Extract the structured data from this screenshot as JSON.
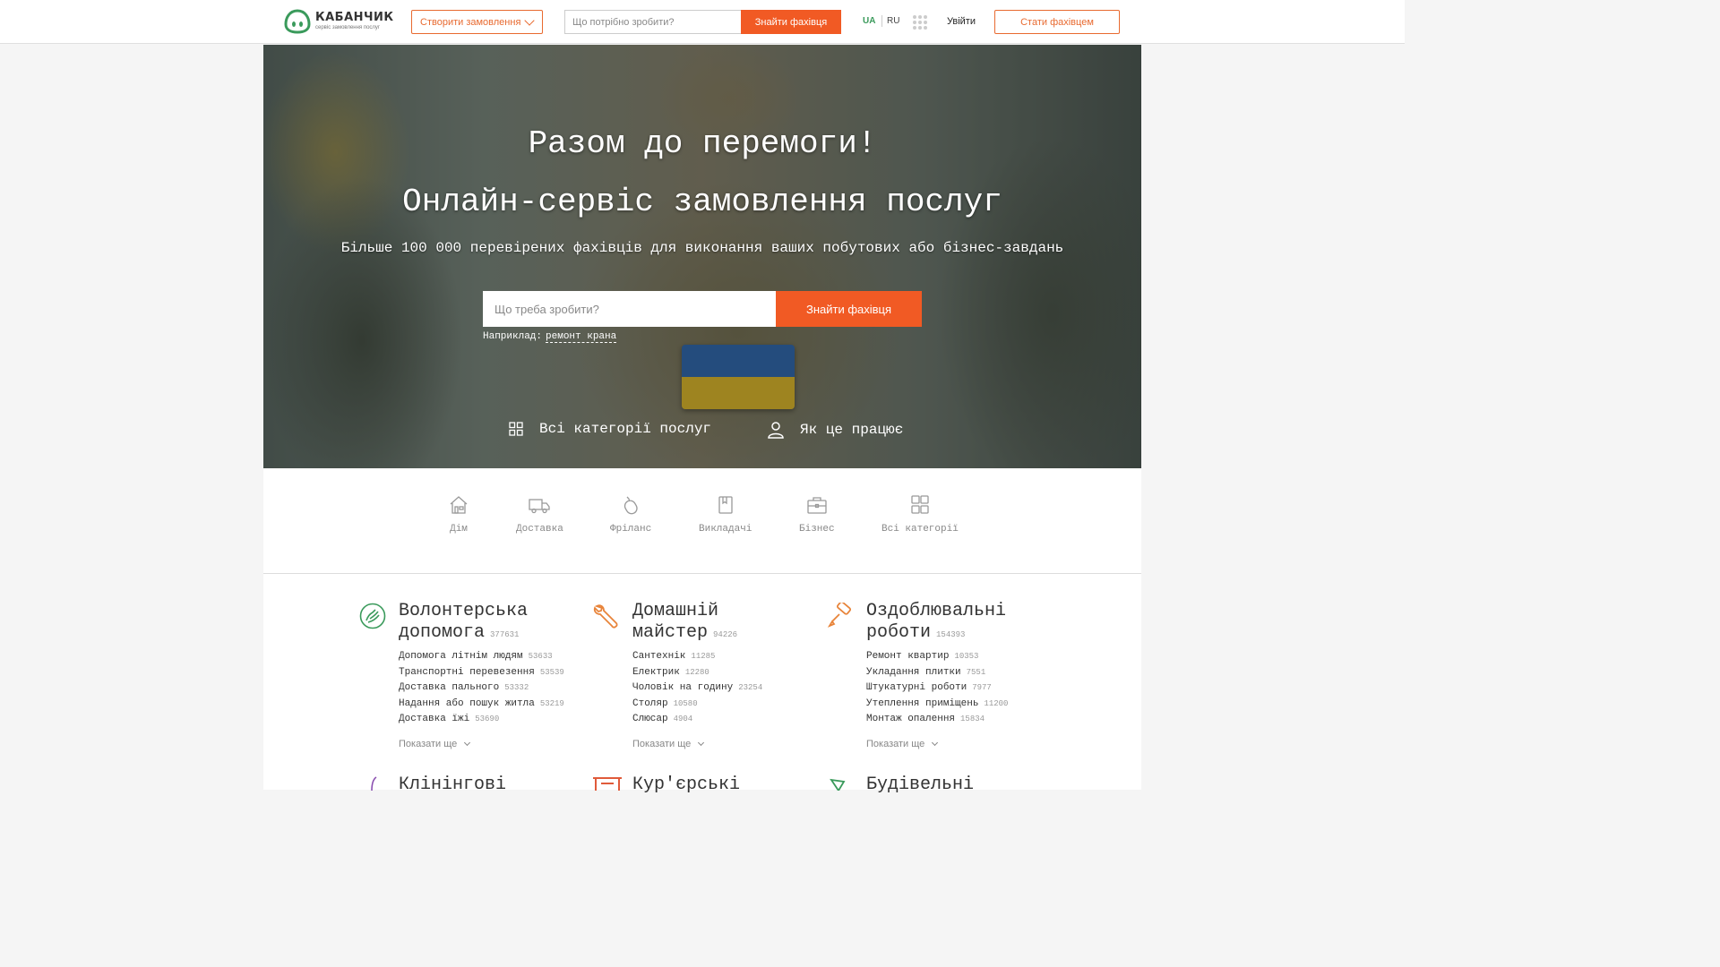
{
  "header": {
    "logo_name": "КАБАНЧИК",
    "logo_sub": "сервіс замовлення послуг",
    "create_order": "Створити замовлення",
    "search_placeholder": "Що потрібно зробити?",
    "find_button": "Знайти фахівця",
    "lang_ua": "UA",
    "lang_ru": "RU",
    "login": "Увійти",
    "become_specialist": "Стати фахівцем"
  },
  "hero": {
    "title_1": "Разом до перемоги!",
    "title_2": "Онлайн-сервіс замовлення послуг",
    "subtitle": "Більше 100 000 перевірених фахівців для виконання ваших побутових або бізнес-завдань",
    "search_placeholder": "Що треба зробити?",
    "find_button": "Знайти фахівця",
    "example_label": "Наприклад:",
    "example_link": "ремонт крана",
    "all_categories": "Всі категорії послуг",
    "how_it_works": "Як це працює"
  },
  "tabs": [
    {
      "label": "Дім",
      "icon": "house-icon"
    },
    {
      "label": "Доставка",
      "icon": "truck-icon"
    },
    {
      "label": "Фріланс",
      "icon": "mouse-icon"
    },
    {
      "label": "Викладачі",
      "icon": "book-icon"
    },
    {
      "label": "Бізнес",
      "icon": "briefcase-icon"
    },
    {
      "label": "Всі категорії",
      "icon": "grid-icon"
    }
  ],
  "categories": [
    {
      "title_1": "Волонтерська",
      "title_2": "допомога",
      "count": "377631",
      "icon": "volunteer-hand-icon",
      "color": "#3a9a5b",
      "items": [
        {
          "label": "Допомога літнім людям",
          "count": "53633"
        },
        {
          "label": "Транспортні перевезення",
          "count": "53539"
        },
        {
          "label": "Доставка пального",
          "count": "53332"
        },
        {
          "label": "Надання або пошук житла",
          "count": "53219"
        },
        {
          "label": "Доставка їжі",
          "count": "53690"
        }
      ],
      "more": "Показати ще"
    },
    {
      "title_1": "Домашній",
      "title_2": "майстер",
      "count": "94226",
      "icon": "wrench-icon",
      "color": "#e8843a",
      "items": [
        {
          "label": "Сантехнік",
          "count": "11285"
        },
        {
          "label": "Електрик",
          "count": "12280"
        },
        {
          "label": "Чоловік на годину",
          "count": "23254"
        },
        {
          "label": "Столяр",
          "count": "10580"
        },
        {
          "label": "Слюсар",
          "count": "4904"
        }
      ],
      "more": "Показати ще"
    },
    {
      "title_1": "Оздоблювальні",
      "title_2": "роботи",
      "count": "154393",
      "icon": "paint-roller-icon",
      "color": "#e8843a",
      "items": [
        {
          "label": "Ремонт квартир",
          "count": "10353"
        },
        {
          "label": "Укладання плитки",
          "count": "7551"
        },
        {
          "label": "Штукатурні роботи",
          "count": "7977"
        },
        {
          "label": "Утеплення приміщень",
          "count": "11200"
        },
        {
          "label": "Монтаж опалення",
          "count": "15834"
        }
      ],
      "more": "Показати ще"
    }
  ],
  "categories_row2": [
    "Клінінгові",
    "Кур'єрські",
    "Будівельні"
  ]
}
